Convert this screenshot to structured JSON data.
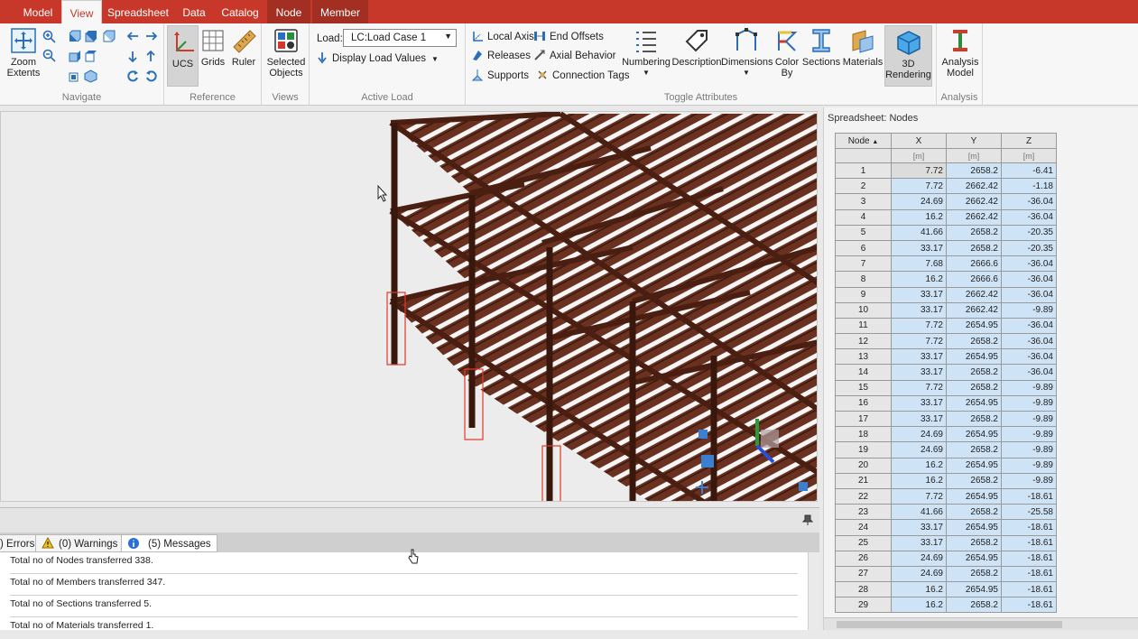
{
  "menu": [
    "Model",
    "View",
    "Spreadsheet",
    "Data",
    "Catalog",
    "Node",
    "Member"
  ],
  "ribbon": {
    "navigate": {
      "zoom_extents": "Zoom\nExtents",
      "label": "Navigate"
    },
    "reference": {
      "ucs": "UCS",
      "grids": "Grids",
      "ruler": "Ruler",
      "label": "Reference"
    },
    "views": {
      "selected_objects": "Selected\nObjects",
      "label": "Views"
    },
    "active_load": {
      "load_label": "Load:",
      "load_value": "LC:Load Case 1",
      "display_load_values": "Display Load Values",
      "label": "Active Load"
    },
    "toggle": {
      "local_axis": "Local Axis",
      "releases": "Releases",
      "supports": "Supports",
      "end_offsets": "End Offsets",
      "axial_behavior": "Axial Behavior",
      "connection_tags": "Connection Tags",
      "numbering": "Numbering",
      "description": "Description",
      "dimensions": "Dimensions",
      "color_by": "Color\nBy",
      "sections": "Sections",
      "materials": "Materials",
      "rendering": "3D\nRendering",
      "label": "Toggle Attributes"
    },
    "analysis": {
      "analysis_model": "Analysis\nModel",
      "label": "Analysis"
    }
  },
  "spreadsheet": {
    "title": "Spreadsheet: Nodes",
    "headers": [
      "Node",
      "X",
      "Y",
      "Z"
    ],
    "units": [
      "",
      "[m]",
      "[m]",
      "[m]"
    ],
    "rows": [
      [
        "1",
        "7.72",
        "2658.2",
        "-6.41"
      ],
      [
        "2",
        "7.72",
        "2662.42",
        "-1.18"
      ],
      [
        "3",
        "24.69",
        "2662.42",
        "-36.04"
      ],
      [
        "4",
        "16.2",
        "2662.42",
        "-36.04"
      ],
      [
        "5",
        "41.66",
        "2658.2",
        "-20.35"
      ],
      [
        "6",
        "33.17",
        "2658.2",
        "-20.35"
      ],
      [
        "7",
        "7.68",
        "2666.6",
        "-36.04"
      ],
      [
        "8",
        "16.2",
        "2666.6",
        "-36.04"
      ],
      [
        "9",
        "33.17",
        "2662.42",
        "-36.04"
      ],
      [
        "10",
        "33.17",
        "2662.42",
        "-9.89"
      ],
      [
        "11",
        "7.72",
        "2654.95",
        "-36.04"
      ],
      [
        "12",
        "7.72",
        "2658.2",
        "-36.04"
      ],
      [
        "13",
        "33.17",
        "2654.95",
        "-36.04"
      ],
      [
        "14",
        "33.17",
        "2658.2",
        "-36.04"
      ],
      [
        "15",
        "7.72",
        "2658.2",
        "-9.89"
      ],
      [
        "16",
        "33.17",
        "2654.95",
        "-9.89"
      ],
      [
        "17",
        "33.17",
        "2658.2",
        "-9.89"
      ],
      [
        "18",
        "24.69",
        "2654.95",
        "-9.89"
      ],
      [
        "19",
        "24.69",
        "2658.2",
        "-9.89"
      ],
      [
        "20",
        "16.2",
        "2654.95",
        "-9.89"
      ],
      [
        "21",
        "16.2",
        "2658.2",
        "-9.89"
      ],
      [
        "22",
        "7.72",
        "2654.95",
        "-18.61"
      ],
      [
        "23",
        "41.66",
        "2658.2",
        "-25.58"
      ],
      [
        "24",
        "33.17",
        "2654.95",
        "-18.61"
      ],
      [
        "25",
        "33.17",
        "2658.2",
        "-18.61"
      ],
      [
        "26",
        "24.69",
        "2654.95",
        "-18.61"
      ],
      [
        "27",
        "24.69",
        "2658.2",
        "-18.61"
      ],
      [
        "28",
        "16.2",
        "2654.95",
        "-18.61"
      ],
      [
        "29",
        "16.2",
        "2658.2",
        "-18.61"
      ]
    ]
  },
  "bottom": {
    "tabs": {
      "errors": ") Errors",
      "warnings": "(0) Warnings",
      "messages": "(5) Messages"
    },
    "messages": [
      "Total no of Nodes transferred 338.",
      "Total no of Members transferred 347.",
      "Total no of Sections transferred 5.",
      "Total no of Materials transferred 1."
    ]
  },
  "colors": {
    "accent": "#c8382a",
    "steel": "#6b3220",
    "cell_blue": "#cfe3f6"
  }
}
